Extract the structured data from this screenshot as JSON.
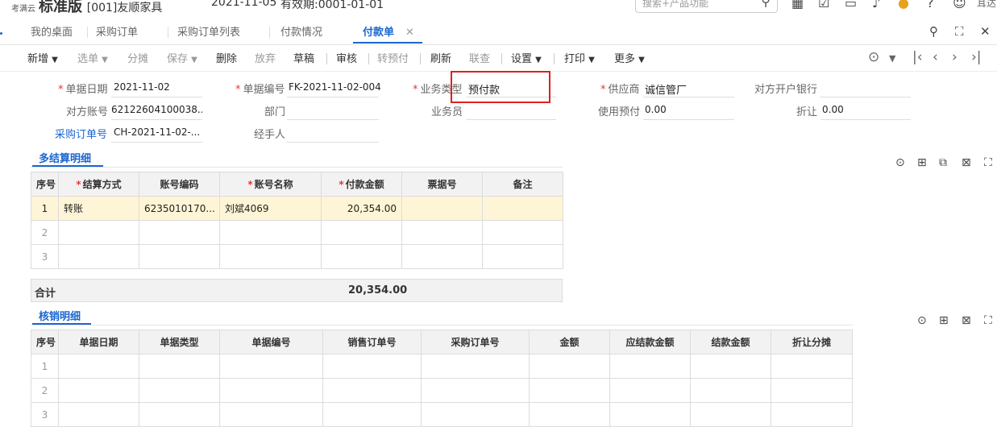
{
  "titlebar": {
    "brand_small": "考满云",
    "brand_big": "标准版",
    "account": "[001]友顺家具",
    "date": "2021-11-05",
    "validity": "有效期:0001-01-01",
    "search_placeholder": "搜索+产品功能",
    "user_fragment": "耳达"
  },
  "tabs": [
    {
      "label": "我的桌面"
    },
    {
      "label": "采购订单"
    },
    {
      "label": "采购订单列表"
    },
    {
      "label": "付款情况"
    },
    {
      "label": "付款单",
      "active": true,
      "close": "✕"
    }
  ],
  "toolbar": {
    "new": "新增",
    "select": "选单",
    "split": "分摊",
    "save": "保存",
    "delete": "删除",
    "discard": "放弃",
    "draft": "草稿",
    "audit": "审核",
    "to_prepay": "转预付",
    "refresh": "刷新",
    "linked": "联查",
    "settings": "设置",
    "print": "打印",
    "more": "更多"
  },
  "form": {
    "doc_date_label": "单据日期",
    "doc_date": "2021-11-02",
    "doc_no_label": "单据编号",
    "doc_no": "FK-2021-11-02-004",
    "biz_type_label": "业务类型",
    "biz_type": "预付款",
    "supplier_label": "供应商",
    "supplier": "诚信管厂",
    "bank_label": "对方开户银行",
    "bank": "",
    "account_label": "对方账号",
    "account": "62122604100038...",
    "dept_label": "部门",
    "dept": "",
    "clerk_label": "业务员",
    "clerk": "",
    "prepay_used_label": "使用预付",
    "prepay_used": "0.00",
    "discount_label": "折让",
    "discount": "0.00",
    "po_label": "采购订单号",
    "po": "CH-2021-11-02-...",
    "handler_label": "经手人",
    "handler": ""
  },
  "settlement": {
    "title": "多结算明细",
    "headers": [
      "序号",
      "结算方式",
      "账号编码",
      "账号名称",
      "付款金额",
      "票据号",
      "备注"
    ],
    "rows": [
      [
        "1",
        "转账",
        "6235010170...",
        "刘斌4069",
        "20,354.00",
        "",
        ""
      ],
      [
        "2",
        "",
        "",
        "",
        "",
        "",
        ""
      ],
      [
        "3",
        "",
        "",
        "",
        "",
        "",
        ""
      ]
    ],
    "total_label": "合计",
    "total": "20,354.00"
  },
  "writeoff": {
    "title": "核销明细",
    "headers": [
      "序号",
      "单据日期",
      "单据类型",
      "单据编号",
      "销售订单号",
      "采购订单号",
      "金额",
      "应结款金额",
      "结款金额",
      "折让分摊"
    ],
    "rows": [
      [
        "1",
        "",
        "",
        "",
        "",
        "",
        "",
        "",
        "",
        ""
      ],
      [
        "2",
        "",
        "",
        "",
        "",
        "",
        "",
        "",
        "",
        ""
      ],
      [
        "3",
        "",
        "",
        "",
        "",
        "",
        "",
        "",
        "",
        ""
      ]
    ]
  },
  "colors": {
    "accent": "#1a66d1",
    "highlight_row": "#fdf5d6",
    "red_box": "#e02020"
  }
}
